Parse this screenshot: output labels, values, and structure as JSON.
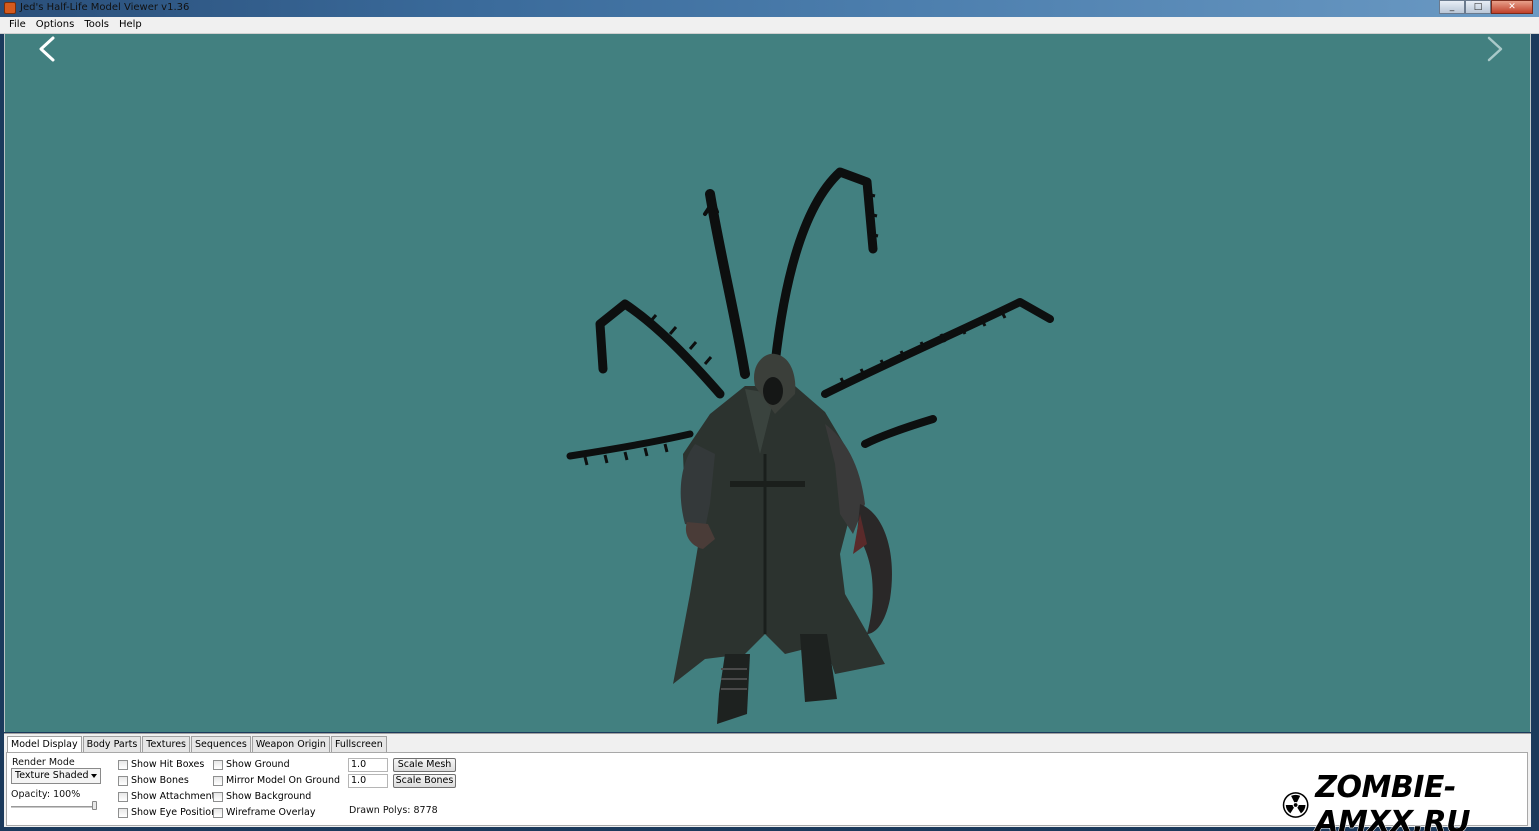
{
  "window": {
    "title": "Jed's Half-Life Model Viewer v1.36",
    "buttons": {
      "minimize": "_",
      "maximize": "□",
      "close": "✕"
    }
  },
  "menubar": {
    "items": [
      "File",
      "Options",
      "Tools",
      "Help"
    ]
  },
  "viewport": {
    "background_color": "#428080",
    "model_description_icon": "creature-model",
    "nav_prev_icon": "chevron-left-icon",
    "nav_next_icon": "chevron-right-icon"
  },
  "panel": {
    "tabs": [
      "Model Display",
      "Body Parts",
      "Textures",
      "Sequences",
      "Weapon Origin",
      "Fullscreen"
    ],
    "active_tab": "Model Display",
    "render_mode": {
      "label": "Render Mode",
      "value": "Texture Shaded"
    },
    "opacity": {
      "label": "Opacity: 100%",
      "value_percent": 100
    },
    "checkboxes_col1": [
      "Show Hit Boxes",
      "Show Bones",
      "Show Attachments",
      "Show Eye Position"
    ],
    "checkboxes_col2": [
      "Show Ground",
      "Mirror Model On Ground",
      "Show Background",
      "Wireframe Overlay"
    ],
    "scale_mesh": {
      "value": "1.0",
      "button": "Scale Mesh"
    },
    "scale_bones": {
      "value": "1.0",
      "button": "Scale Bones"
    },
    "drawn_polys": "Drawn Polys: 8778"
  },
  "watermark": {
    "text": "ZOMBIE-AMXX.RU",
    "icon": "radiation-icon"
  }
}
